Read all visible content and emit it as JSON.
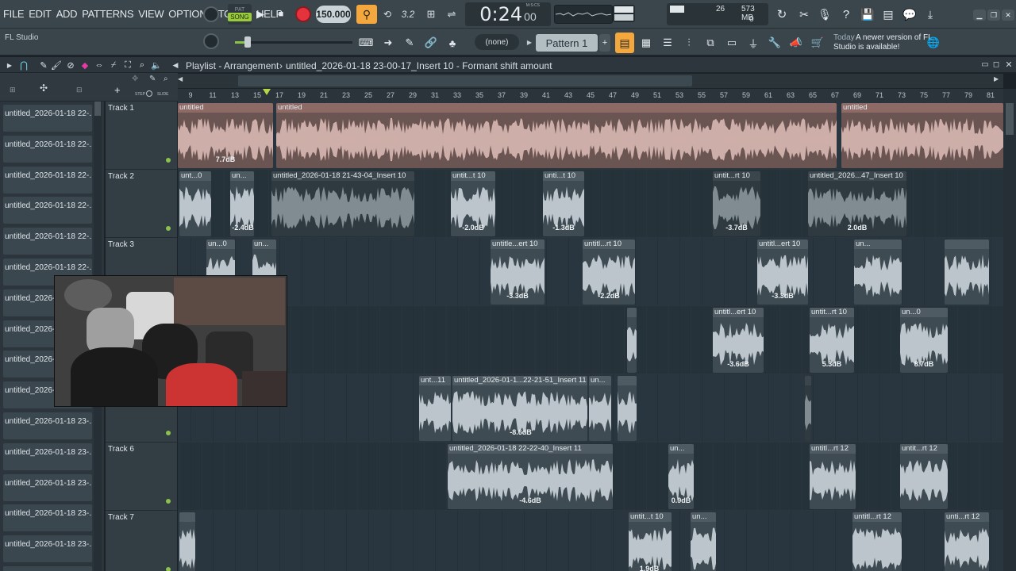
{
  "menu": [
    "FILE",
    "EDIT",
    "ADD",
    "PATTERNS",
    "VIEW",
    "OPTIONS",
    "TOOLS",
    "HELP"
  ],
  "toolbar": {
    "mode_label": "SONG",
    "pat_label": "PAT",
    "tempo": "150.000",
    "time": "0:24",
    "time_sub": "00",
    "time_unit": "M:S:CS",
    "cpu": "26",
    "mem": "573 MB",
    "voices": "0",
    "pattern": "Pattern 1",
    "none_select": "(none)",
    "snap_label": "3.2"
  },
  "status": {
    "app_name": "FL Studio",
    "news_date": "Today",
    "news_text": "A newer version of FL Studio is available!"
  },
  "playlist": {
    "title": "Playlist - Arrangement",
    "path": "untitled_2026-01-18 23-00-17_Insert 10 - Formant shift amount",
    "step_label": "STEP",
    "slide_label": "SLIDE"
  },
  "ruler": [
    "9",
    "11",
    "13",
    "15",
    "17",
    "19",
    "21",
    "23",
    "25",
    "27",
    "29",
    "31",
    "33",
    "35",
    "37",
    "39",
    "41",
    "43",
    "45",
    "47",
    "49",
    "51",
    "53",
    "55",
    "57",
    "59",
    "61",
    "63",
    "65",
    "67",
    "69",
    "71",
    "73",
    "75",
    "77",
    "79",
    "81"
  ],
  "picker": [
    "untitled_2026-01-18 22-...",
    "untitled_2026-01-18 22-...",
    "untitled_2026-01-18 22-...",
    "untitled_2026-01-18 22-...",
    "untitled_2026-01-18 22-...",
    "untitled_2026-01-18 22-...",
    "untitled_2026-0",
    "untitled_2026-0",
    "untitled_2026-0",
    "untitled_2026-0",
    "untitled_2026-01-18 23-...",
    "untitled_2026-01-18 23-...",
    "untitled_2026-01-18 23-...",
    "untitled_2026-01-18 23-...",
    "untitled_2026-01-18 23-...",
    "untitled_2026-01-18 23-..."
  ],
  "tracks": [
    {
      "name": "Track 1",
      "clips": [
        {
          "label": "untitled",
          "start": 0,
          "width": 120,
          "pink": true,
          "db": "7.7dB",
          "dbx": 60
        },
        {
          "label": "untitled",
          "start": 124,
          "width": 706,
          "pink": true
        },
        {
          "label": "untitled",
          "start": 836,
          "width": 204,
          "pink": true
        }
      ]
    },
    {
      "name": "Track 2",
      "clips": [
        {
          "label": "unt...0",
          "start": 2,
          "width": 40,
          "db": ""
        },
        {
          "label": "un...",
          "start": 66,
          "width": 30,
          "db": "-2.4dB",
          "dbx": 16
        },
        {
          "label": "untitled_2026-01-18 21-43-04_Insert 10",
          "start": 118,
          "width": 180,
          "db": "",
          "muted": true
        },
        {
          "label": "untit...t 10",
          "start": 344,
          "width": 56,
          "db": "-2.0dB",
          "dbx": 28
        },
        {
          "label": "unti...t 10",
          "start": 460,
          "width": 52,
          "db": "-1.3dB",
          "dbx": 26
        },
        {
          "label": "untit...rt 10",
          "start": 674,
          "width": 60,
          "db": "-3.7dB",
          "dbx": 30,
          "muted": true
        },
        {
          "label": "untitled_2026...47_Insert 10",
          "start": 794,
          "width": 124,
          "db": "2.0dB",
          "dbx": 62,
          "muted": true
        }
      ]
    },
    {
      "name": "Track 3",
      "clips": [
        {
          "label": "un...0",
          "start": 36,
          "width": 36,
          "db": ""
        },
        {
          "label": "un...",
          "start": 94,
          "width": 30,
          "db": ""
        },
        {
          "label": "untitle...ert 10",
          "start": 394,
          "width": 68,
          "db": "-3.3dB",
          "dbx": 34
        },
        {
          "label": "untitl...rt 10",
          "start": 510,
          "width": 66,
          "db": "-2.2dB",
          "dbx": 33
        },
        {
          "label": "untitl...ert 10",
          "start": 730,
          "width": 64,
          "db": "-3.3dB",
          "dbx": 32
        },
        {
          "label": "un...",
          "start": 852,
          "width": 60,
          "db": ""
        },
        {
          "label": "",
          "start": 966,
          "width": 56,
          "db": ""
        }
      ]
    },
    {
      "name": "",
      "clips": [
        {
          "label": "",
          "start": 566,
          "width": 12,
          "db": ""
        },
        {
          "label": "untitl...ert 10",
          "start": 674,
          "width": 64,
          "db": "-3.6dB",
          "dbx": 32
        },
        {
          "label": "untit...rt 10",
          "start": 796,
          "width": 56,
          "db": "5.3dB",
          "dbx": 28
        },
        {
          "label": "un...0",
          "start": 910,
          "width": 60,
          "db": "8.7dB",
          "dbx": 30
        }
      ]
    },
    {
      "name": "",
      "clips": [
        {
          "label": "unt...11",
          "start": 304,
          "width": 40,
          "db": ""
        },
        {
          "label": "untitled_2026-01-1...22-21-51_Insert 11",
          "start": 346,
          "width": 170,
          "db": "-8.6dB",
          "dbx": 86
        },
        {
          "label": "un...",
          "start": 518,
          "width": 28,
          "db": ""
        },
        {
          "label": "",
          "start": 554,
          "width": 24,
          "db": ""
        },
        {
          "label": "",
          "start": 790,
          "width": 8,
          "db": "",
          "muted": true
        }
      ]
    },
    {
      "name": "Track 6",
      "clips": [
        {
          "label": "untitled_2026-01-18 22-22-40_Insert 11",
          "start": 340,
          "width": 208,
          "db": "-4.6dB",
          "dbx": 104
        },
        {
          "label": "un...",
          "start": 618,
          "width": 32,
          "db": "0.9dB",
          "dbx": 16
        },
        {
          "label": "untitl...rt 12",
          "start": 796,
          "width": 58,
          "db": ""
        },
        {
          "label": "untit...rt 12",
          "start": 910,
          "width": 60,
          "db": ""
        }
      ]
    },
    {
      "name": "Track 7",
      "clips": [
        {
          "label": "",
          "start": 2,
          "width": 20,
          "db": ""
        },
        {
          "label": "untit...t 10",
          "start": 568,
          "width": 54,
          "db": "1.9dB",
          "dbx": 26
        },
        {
          "label": "un...",
          "start": 646,
          "width": 32,
          "db": ""
        },
        {
          "label": "untitl...rt 12",
          "start": 850,
          "width": 62,
          "db": ""
        },
        {
          "label": "unti...rt 12",
          "start": 966,
          "width": 56,
          "db": ""
        }
      ]
    }
  ],
  "colors": {
    "clip": "#3f4b52",
    "clip_hdr": "#4e5b62",
    "pink": "#d8b8b2",
    "pink_hdr": "#8e6a66",
    "wave": "#c9d3d8",
    "accent_orange": "#f3a73c",
    "record_red": "#e5333d"
  }
}
